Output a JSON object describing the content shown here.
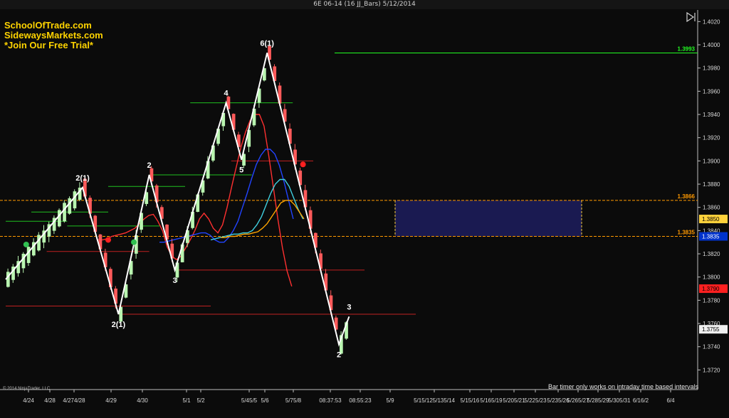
{
  "window": {
    "title": "6E 06-14 (16 JJ_Bars)  5/12/2014"
  },
  "branding": {
    "lines": [
      "SchoolOfTrade.com",
      "SidewaysMarkets.com",
      "*Join Our Free Trial*"
    ]
  },
  "footer": {
    "copyright": "© 2014 NinjaTrader, LLC",
    "bar_timer_note": "Bar timer only works on intraday time based intervals"
  },
  "colors": {
    "background": "#0b0b0b",
    "bull_bar": "#b9f5b0",
    "bear_bar": "#ff5a5a",
    "zigzag": "#ffffff",
    "zone_fill": "#1b1b55",
    "zone_line": "#ffa500",
    "green_line": "#1fbf1f",
    "red_line": "#c02020",
    "price_tag": "#e8e8e8"
  },
  "chart_data": {
    "type": "line",
    "title": "6E 06-14 (16 JJ_Bars)  5/12/2014",
    "ylim": [
      1.3708,
      1.403
    ],
    "y_ticks": [
      "1.4020",
      "1.4000",
      "1.3980",
      "1.3960",
      "1.3940",
      "1.3920",
      "1.3900",
      "1.3880",
      "1.3860",
      "1.3840",
      "1.3820",
      "1.3800",
      "1.3780",
      "1.3760",
      "1.3740",
      "1.3720"
    ],
    "x_tick_labels": [
      "4/24",
      "4/28",
      "4/274/28",
      "4/29",
      "4/30",
      "5/1",
      "5/2",
      "5/45/5",
      "5/6",
      "5/75/8",
      "08:37:53",
      "08:55:23",
      "5/9",
      "5/15/125/135/14",
      "5/15/16",
      "5/165/19",
      "5/205/21",
      "5/225/23",
      "5/235/26",
      "5/265/27",
      "5/285/29",
      "5/305/31",
      "6/16/2",
      "6/4"
    ],
    "zigzag_points": [
      {
        "bar": 0,
        "price": 1.3798,
        "label": ""
      },
      {
        "bar": 15,
        "price": 1.3877,
        "label": "2(1)"
      },
      {
        "bar": 22,
        "price": 1.3768,
        "label": "2(1)"
      },
      {
        "bar": 28,
        "price": 1.3888,
        "label": "2"
      },
      {
        "bar": 33,
        "price": 1.3806,
        "label": "3"
      },
      {
        "bar": 43,
        "price": 1.395,
        "label": "4"
      },
      {
        "bar": 46,
        "price": 1.3901,
        "label": "5"
      },
      {
        "bar": 51,
        "price": 1.3993,
        "label": "6(1)"
      },
      {
        "bar": 65,
        "price": 1.3742,
        "label": "2"
      },
      {
        "bar": 67,
        "price": 1.3766,
        "label": "3"
      }
    ],
    "levels": [
      {
        "label": "1.3993",
        "price": 1.3993,
        "color": "#22ff22"
      },
      {
        "label": "1.3866",
        "price": 1.3866,
        "color": "#ff9900"
      },
      {
        "label": "1.3835",
        "price": 1.3835,
        "color": "#ff9900"
      }
    ],
    "price_tags": [
      {
        "label": "1.3850",
        "price": 1.385,
        "bg": "#ffd23c",
        "fg": "#000000"
      },
      {
        "label": "1.3835",
        "price": 1.3835,
        "bg": "#0033cc",
        "fg": "#ffffff"
      },
      {
        "label": "1.3790",
        "price": 1.379,
        "bg": "#ff2020",
        "fg": "#000000"
      },
      {
        "label": "1.3755",
        "price": 1.3755,
        "bg": "#f0f0f0",
        "fg": "#000000"
      }
    ],
    "series": [
      {
        "name": "",
        "color": "#ff3030",
        "values": [
          1.3832,
          1.3832,
          1.3833,
          1.3835,
          1.3836,
          1.3837,
          1.3838,
          1.384,
          1.3842,
          1.3846,
          1.385,
          1.3853,
          1.3854,
          1.3848,
          1.384,
          1.3826,
          1.3818,
          1.3815,
          1.3818,
          1.3825,
          1.3832,
          1.384,
          1.385,
          1.3855,
          1.385,
          1.3842,
          1.3838,
          1.3845,
          1.386,
          1.3878,
          1.3895,
          1.3912,
          1.3925,
          1.3935,
          1.394,
          1.394,
          1.393,
          1.3905,
          1.3878,
          1.385,
          1.3825,
          1.3805,
          1.3792
        ]
      },
      {
        "name": "",
        "color": "#2244ff",
        "values": [
          1.383,
          1.383,
          1.3831,
          1.3832,
          1.3833,
          1.3834,
          1.3835,
          1.3836,
          1.3837,
          1.3838,
          1.3838,
          1.3836,
          1.3832,
          1.383,
          1.383,
          1.3834,
          1.384,
          1.3848,
          1.386,
          1.3872,
          1.3885,
          1.3897,
          1.3905,
          1.391,
          1.391,
          1.3906,
          1.3896,
          1.3882,
          1.3866,
          1.385
        ]
      },
      {
        "name": "",
        "color": "#40d0e0",
        "values": [
          1.3832,
          1.3833,
          1.3834,
          1.3835,
          1.3836,
          1.3837,
          1.3837,
          1.3838,
          1.3838,
          1.384,
          1.3845,
          1.3852,
          1.3862,
          1.3872,
          1.388,
          1.3884,
          1.3884,
          1.3878,
          1.3868,
          1.3858,
          1.385
        ]
      },
      {
        "name": "",
        "color": "#ffa500",
        "values": [
          1.3834,
          1.3834,
          1.3835,
          1.3835,
          1.3836,
          1.3837,
          1.3837,
          1.3838,
          1.3839,
          1.3842,
          1.3846,
          1.3852,
          1.3858,
          1.3864,
          1.3866,
          1.3866,
          1.3862,
          1.3856,
          1.385
        ]
      }
    ],
    "markers": [
      {
        "bar": 4,
        "price": 1.3828,
        "color": "#30c050"
      },
      {
        "bar": 20,
        "price": 1.3832,
        "color": "#ff2020"
      },
      {
        "bar": 25,
        "price": 1.383,
        "color": "#30c050"
      },
      {
        "bar": 58,
        "price": 1.3897,
        "color": "#ff2020"
      }
    ]
  }
}
